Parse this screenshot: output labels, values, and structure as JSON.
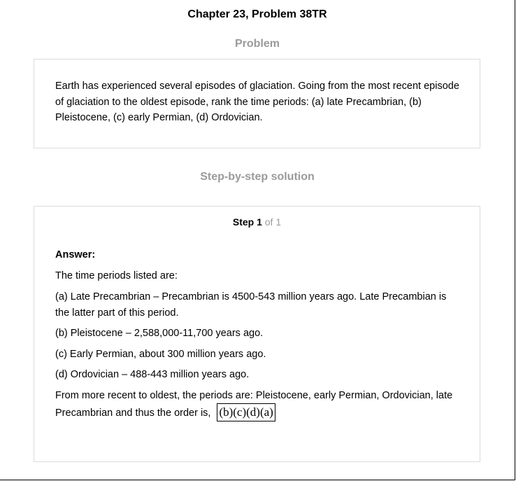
{
  "header": {
    "chapter_title": "Chapter 23, Problem 38TR"
  },
  "problem": {
    "heading": "Problem",
    "text": "Earth has experienced several episodes of glaciation. Going from the most recent episode of glaciation to the oldest episode, rank the time periods: (a) late Precambrian, (b) Pleistocene, (c) early Permian, (d) Ordovician."
  },
  "solution": {
    "heading": "Step-by-step solution",
    "step_word": "Step 1",
    "step_of": " of 1",
    "answer_label": "Answer:",
    "lines": [
      "The time periods listed are:",
      "(a) Late Precambrian – Precambrian is 4500-543 million years ago. Late Precambian is the latter part of this period.",
      "(b) Pleistocene – 2,588,000-11,700 years ago.",
      "(c) Early Permian, about 300 million years ago.",
      "(d) Ordovician – 488-443 million years ago."
    ],
    "conclusion_text": "From more recent to oldest, the periods are: Pleistocene, early Permian, Ordovician, late Precambrian and thus the order is,",
    "boxed_answer": "(b)(c)(d)(a)"
  }
}
